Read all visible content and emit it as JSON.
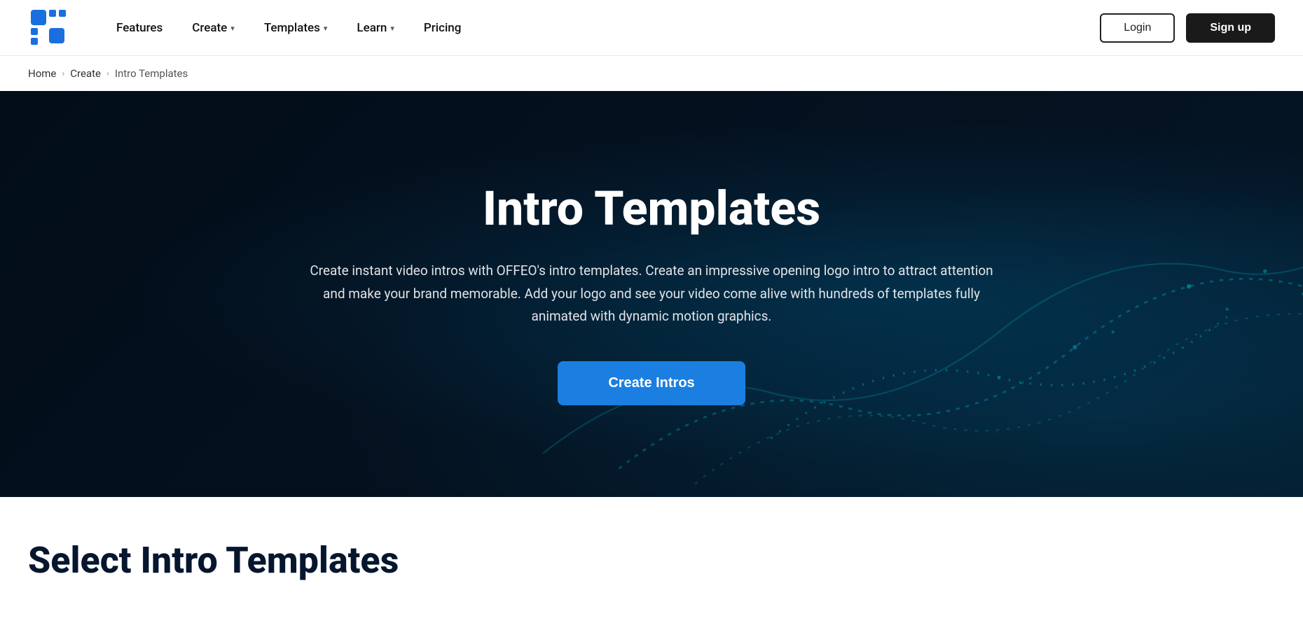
{
  "brand": {
    "name": "OFFEO",
    "logo_alt": "OFFEO logo"
  },
  "navbar": {
    "features_label": "Features",
    "create_label": "Create",
    "templates_label": "Templates",
    "learn_label": "Learn",
    "pricing_label": "Pricing",
    "login_label": "Login",
    "signup_label": "Sign up"
  },
  "breadcrumb": {
    "home_label": "Home",
    "create_label": "Create",
    "current_label": "Intro Templates",
    "separator": "›"
  },
  "hero": {
    "title": "Intro Templates",
    "description": "Create instant video intros with OFFEO's intro templates. Create an impressive opening logo intro to attract attention and make your brand memorable. Add your logo and see your video come alive with hundreds of templates fully animated with dynamic motion graphics.",
    "cta_label": "Create Intros"
  },
  "bottom": {
    "section_title": "Select Intro Templates"
  },
  "colors": {
    "accent_blue": "#1a7fe0",
    "dark_navy": "#04101e",
    "dark_bg": "#1a1a1a",
    "brand_blue": "#1e6fe0"
  }
}
